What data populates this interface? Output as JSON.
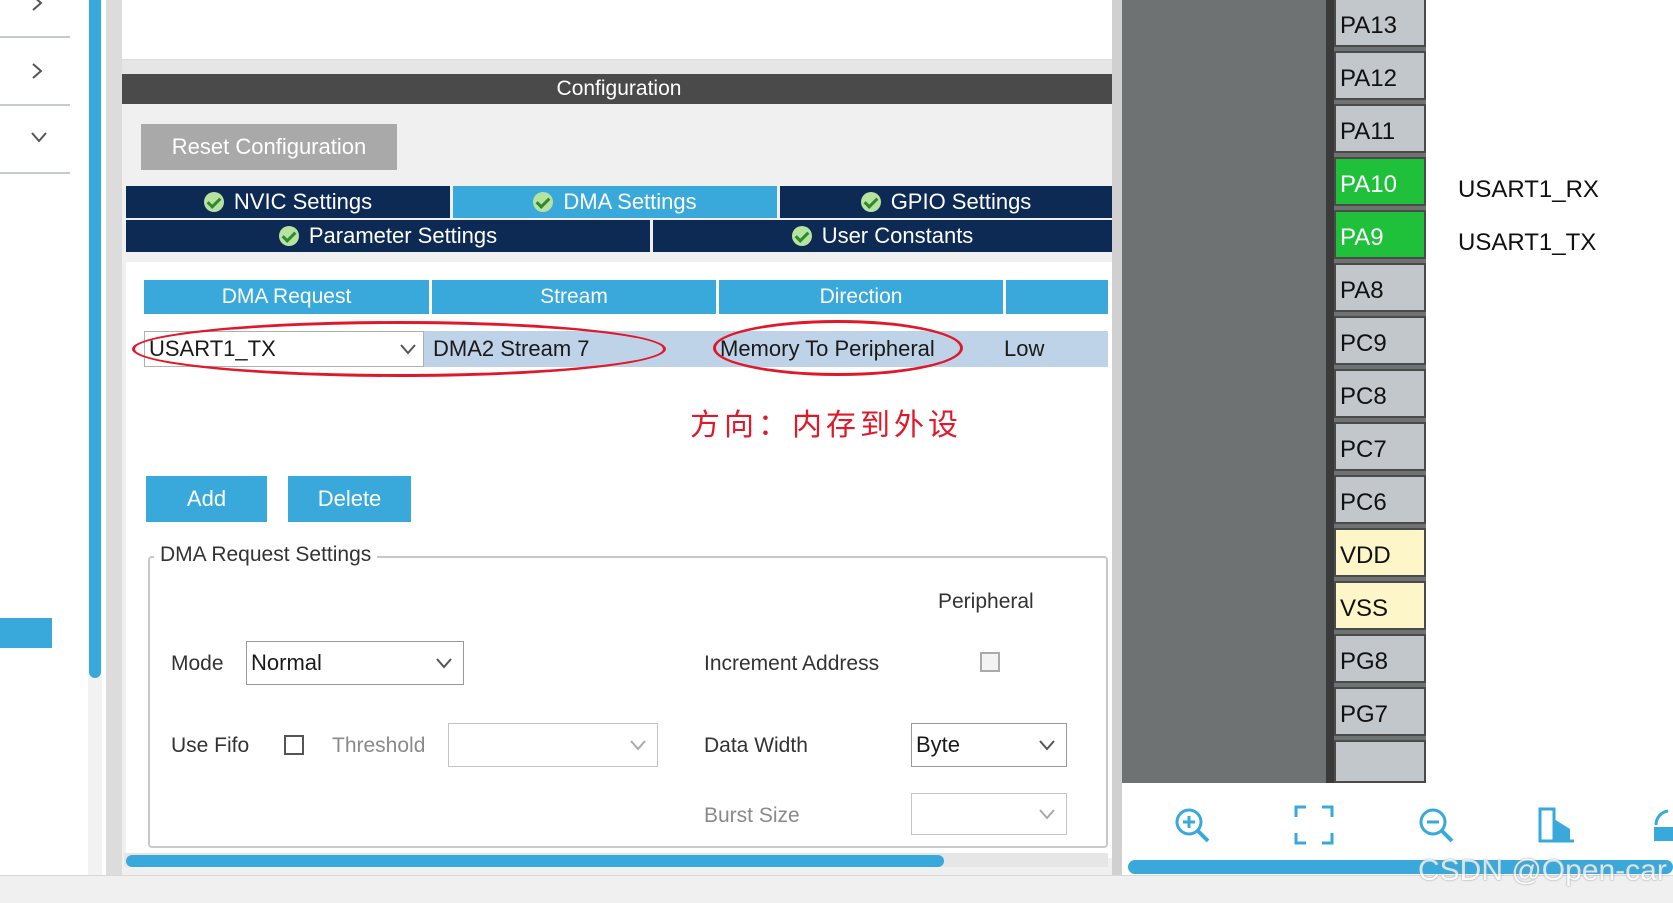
{
  "configuration": {
    "header": "Configuration",
    "reset_button": "Reset Configuration",
    "tabs_row1": [
      "NVIC Settings",
      "DMA Settings",
      "GPIO Settings"
    ],
    "tabs_row2": [
      "Parameter Settings",
      "User Constants"
    ],
    "active_tab": "DMA Settings"
  },
  "dma_table": {
    "columns": [
      "DMA Request",
      "Stream",
      "Direction",
      ""
    ],
    "row": {
      "request": "USART1_TX",
      "stream": "DMA2 Stream 7",
      "direction": "Memory To Peripheral",
      "priority": "Low"
    }
  },
  "annotation": "方向：内存到外设",
  "buttons": {
    "add": "Add",
    "delete": "Delete"
  },
  "request_settings": {
    "title": "DMA Request Settings",
    "peripheral_header": "Peripheral",
    "mode_label": "Mode",
    "mode_value": "Normal",
    "use_fifo_label": "Use Fifo",
    "use_fifo_checked": false,
    "threshold_label": "Threshold",
    "threshold_value": "",
    "increment_address_label": "Increment Address",
    "increment_address_checked": false,
    "data_width_label": "Data Width",
    "data_width_value": "Byte",
    "burst_size_label": "Burst Size",
    "burst_size_value": ""
  },
  "pinout": {
    "pins": [
      {
        "name": "PA13",
        "state": "default",
        "label": ""
      },
      {
        "name": "PA12",
        "state": "default",
        "label": ""
      },
      {
        "name": "PA11",
        "state": "default",
        "label": ""
      },
      {
        "name": "PA10",
        "state": "assigned",
        "label": "USART1_RX"
      },
      {
        "name": "PA9",
        "state": "assigned",
        "label": "USART1_TX"
      },
      {
        "name": "PA8",
        "state": "default",
        "label": ""
      },
      {
        "name": "PC9",
        "state": "default",
        "label": ""
      },
      {
        "name": "PC8",
        "state": "default",
        "label": ""
      },
      {
        "name": "PC7",
        "state": "default",
        "label": ""
      },
      {
        "name": "PC6",
        "state": "default",
        "label": ""
      },
      {
        "name": "VDD",
        "state": "power",
        "label": ""
      },
      {
        "name": "VSS",
        "state": "power",
        "label": ""
      },
      {
        "name": "PG8",
        "state": "default",
        "label": ""
      },
      {
        "name": "PG7",
        "state": "default",
        "label": ""
      }
    ],
    "toolbar_icons": [
      "zoom-in-icon",
      "fit-screen-icon",
      "zoom-out-icon",
      "export-icon",
      "rotate-icon"
    ]
  },
  "watermark": "CSDN @Open-car",
  "colors": {
    "accent": "#39a9dc",
    "tab_dark": "#0d2a55",
    "header_dark": "#4a4a4a",
    "pin_assigned": "#1fc13b",
    "pin_power": "#fdf6c8",
    "annotation_red": "#e0182a"
  }
}
